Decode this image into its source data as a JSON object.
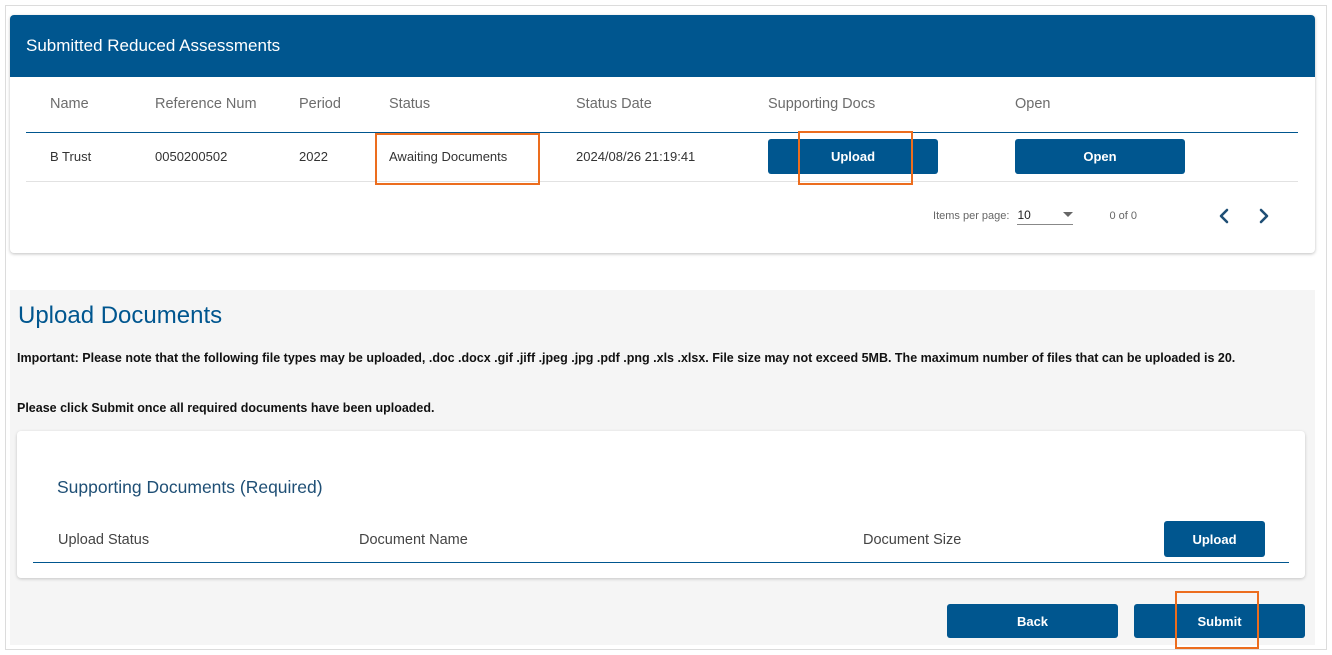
{
  "card": {
    "title": "Submitted Reduced Assessments"
  },
  "table": {
    "columns": [
      "Name",
      "Reference Num",
      "Period",
      "Status",
      "Status Date",
      "Supporting Docs",
      "Open"
    ],
    "rows": [
      {
        "name": "B Trust",
        "reference": "0050200502",
        "period": "2022",
        "status": "Awaiting Documents",
        "status_date": "2024/08/26 21:19:41",
        "docs_button": "Upload",
        "open_button": "Open"
      }
    ]
  },
  "paginator": {
    "items_per_page_label": "Items per page:",
    "items_per_page_value": "10",
    "range": "0 of 0",
    "prev_icon": "chevron-left-icon",
    "next_icon": "chevron-right-icon"
  },
  "upload": {
    "title": "Upload Documents",
    "notice": "Important: Please note that the following file types may be uploaded, .doc .docx .gif .jiff .jpeg .jpg .pdf .png .xls .xlsx. File size may not exceed 5MB. The maximum number of files that can be uploaded is 20.",
    "notice2": "Please click Submit once all required documents have been uploaded.",
    "docs": {
      "title": "Supporting Documents (Required)",
      "columns": {
        "upload_status": "Upload Status",
        "document_name": "Document Name",
        "document_size": "Document Size"
      },
      "upload_button": "Upload"
    },
    "back_button": "Back",
    "submit_button": "Submit"
  },
  "colors": {
    "primary": "#00568f",
    "highlight": "#ec6d1e"
  }
}
